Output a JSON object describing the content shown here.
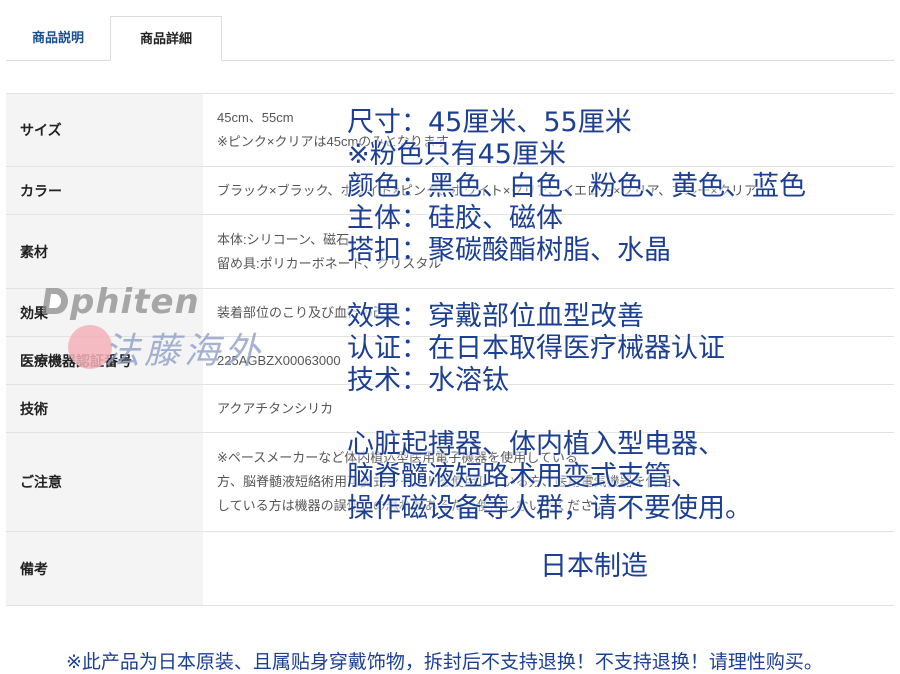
{
  "tabs": [
    {
      "label": "商品説明"
    },
    {
      "label": "商品詳細"
    }
  ],
  "spec": {
    "size": {
      "key": "サイズ",
      "line1": "45cm、55cm",
      "line2": "※ピンク×クリアは45cmのみとなります"
    },
    "color": {
      "key": "カラー",
      "line1": "ブラック×ブラック、ホワイト×ピンク、ホワイト×クリア、イエロー×クリア、ブルー×クリア"
    },
    "material": {
      "key": "素材",
      "line1": "本体:シリコーン、磁石",
      "line2": "留め具:ポリカーボネート、クリスタル"
    },
    "effect": {
      "key": "効果",
      "line1": "装着部位のこり及び血行の改善"
    },
    "cert": {
      "key": "医療機器認証番号",
      "line1": "225AGBZX00063000"
    },
    "tech": {
      "key": "技術",
      "line1": "アクアチタンシリカ"
    },
    "caution": {
      "key": "ご注意",
      "line1": "※ペースメーカーなど体内植込型医用電子機器を使用している",
      "line2": "方、脳脊髄液短絡術用可変式シャントを使用している方、医用電気機器を使用",
      "line3": "している方は機器の誤作動の恐れがあるため使用しないでください。"
    },
    "remarks": {
      "key": "備考",
      "value": ""
    }
  },
  "overlay": {
    "l1": "尺寸：45厘米、55厘米",
    "l2": "※粉色只有45厘米",
    "l3": "颜色：黑色、白色、粉色、黄色、蓝色",
    "l4": "主体：硅胶、磁体",
    "l5": "搭扣：聚碳酸酯树脂、水晶",
    "l6": "效果：穿戴部位血型改善",
    "l7": "认证：在日本取得医疗械器认证",
    "l8": "技术：水溶钛",
    "l9": "心脏起搏器、体内植入型电器、",
    "l10": "脑脊髓液短路术用变式支管、",
    "l11": "操作磁设备等人群，请不要使用。",
    "made_in": "日本制造"
  },
  "watermark": {
    "brand": "phiten",
    "seal": "法藤海外"
  },
  "footnote": "※此产品为日本原装、且属贴身穿戴饰物，拆封后不支持退换！不支持退换！请理性购买。",
  "colors": {
    "accent_blue": "#1c3f94",
    "tab_blue": "#1a4e8f",
    "key_bg": "#f4f4f4"
  }
}
